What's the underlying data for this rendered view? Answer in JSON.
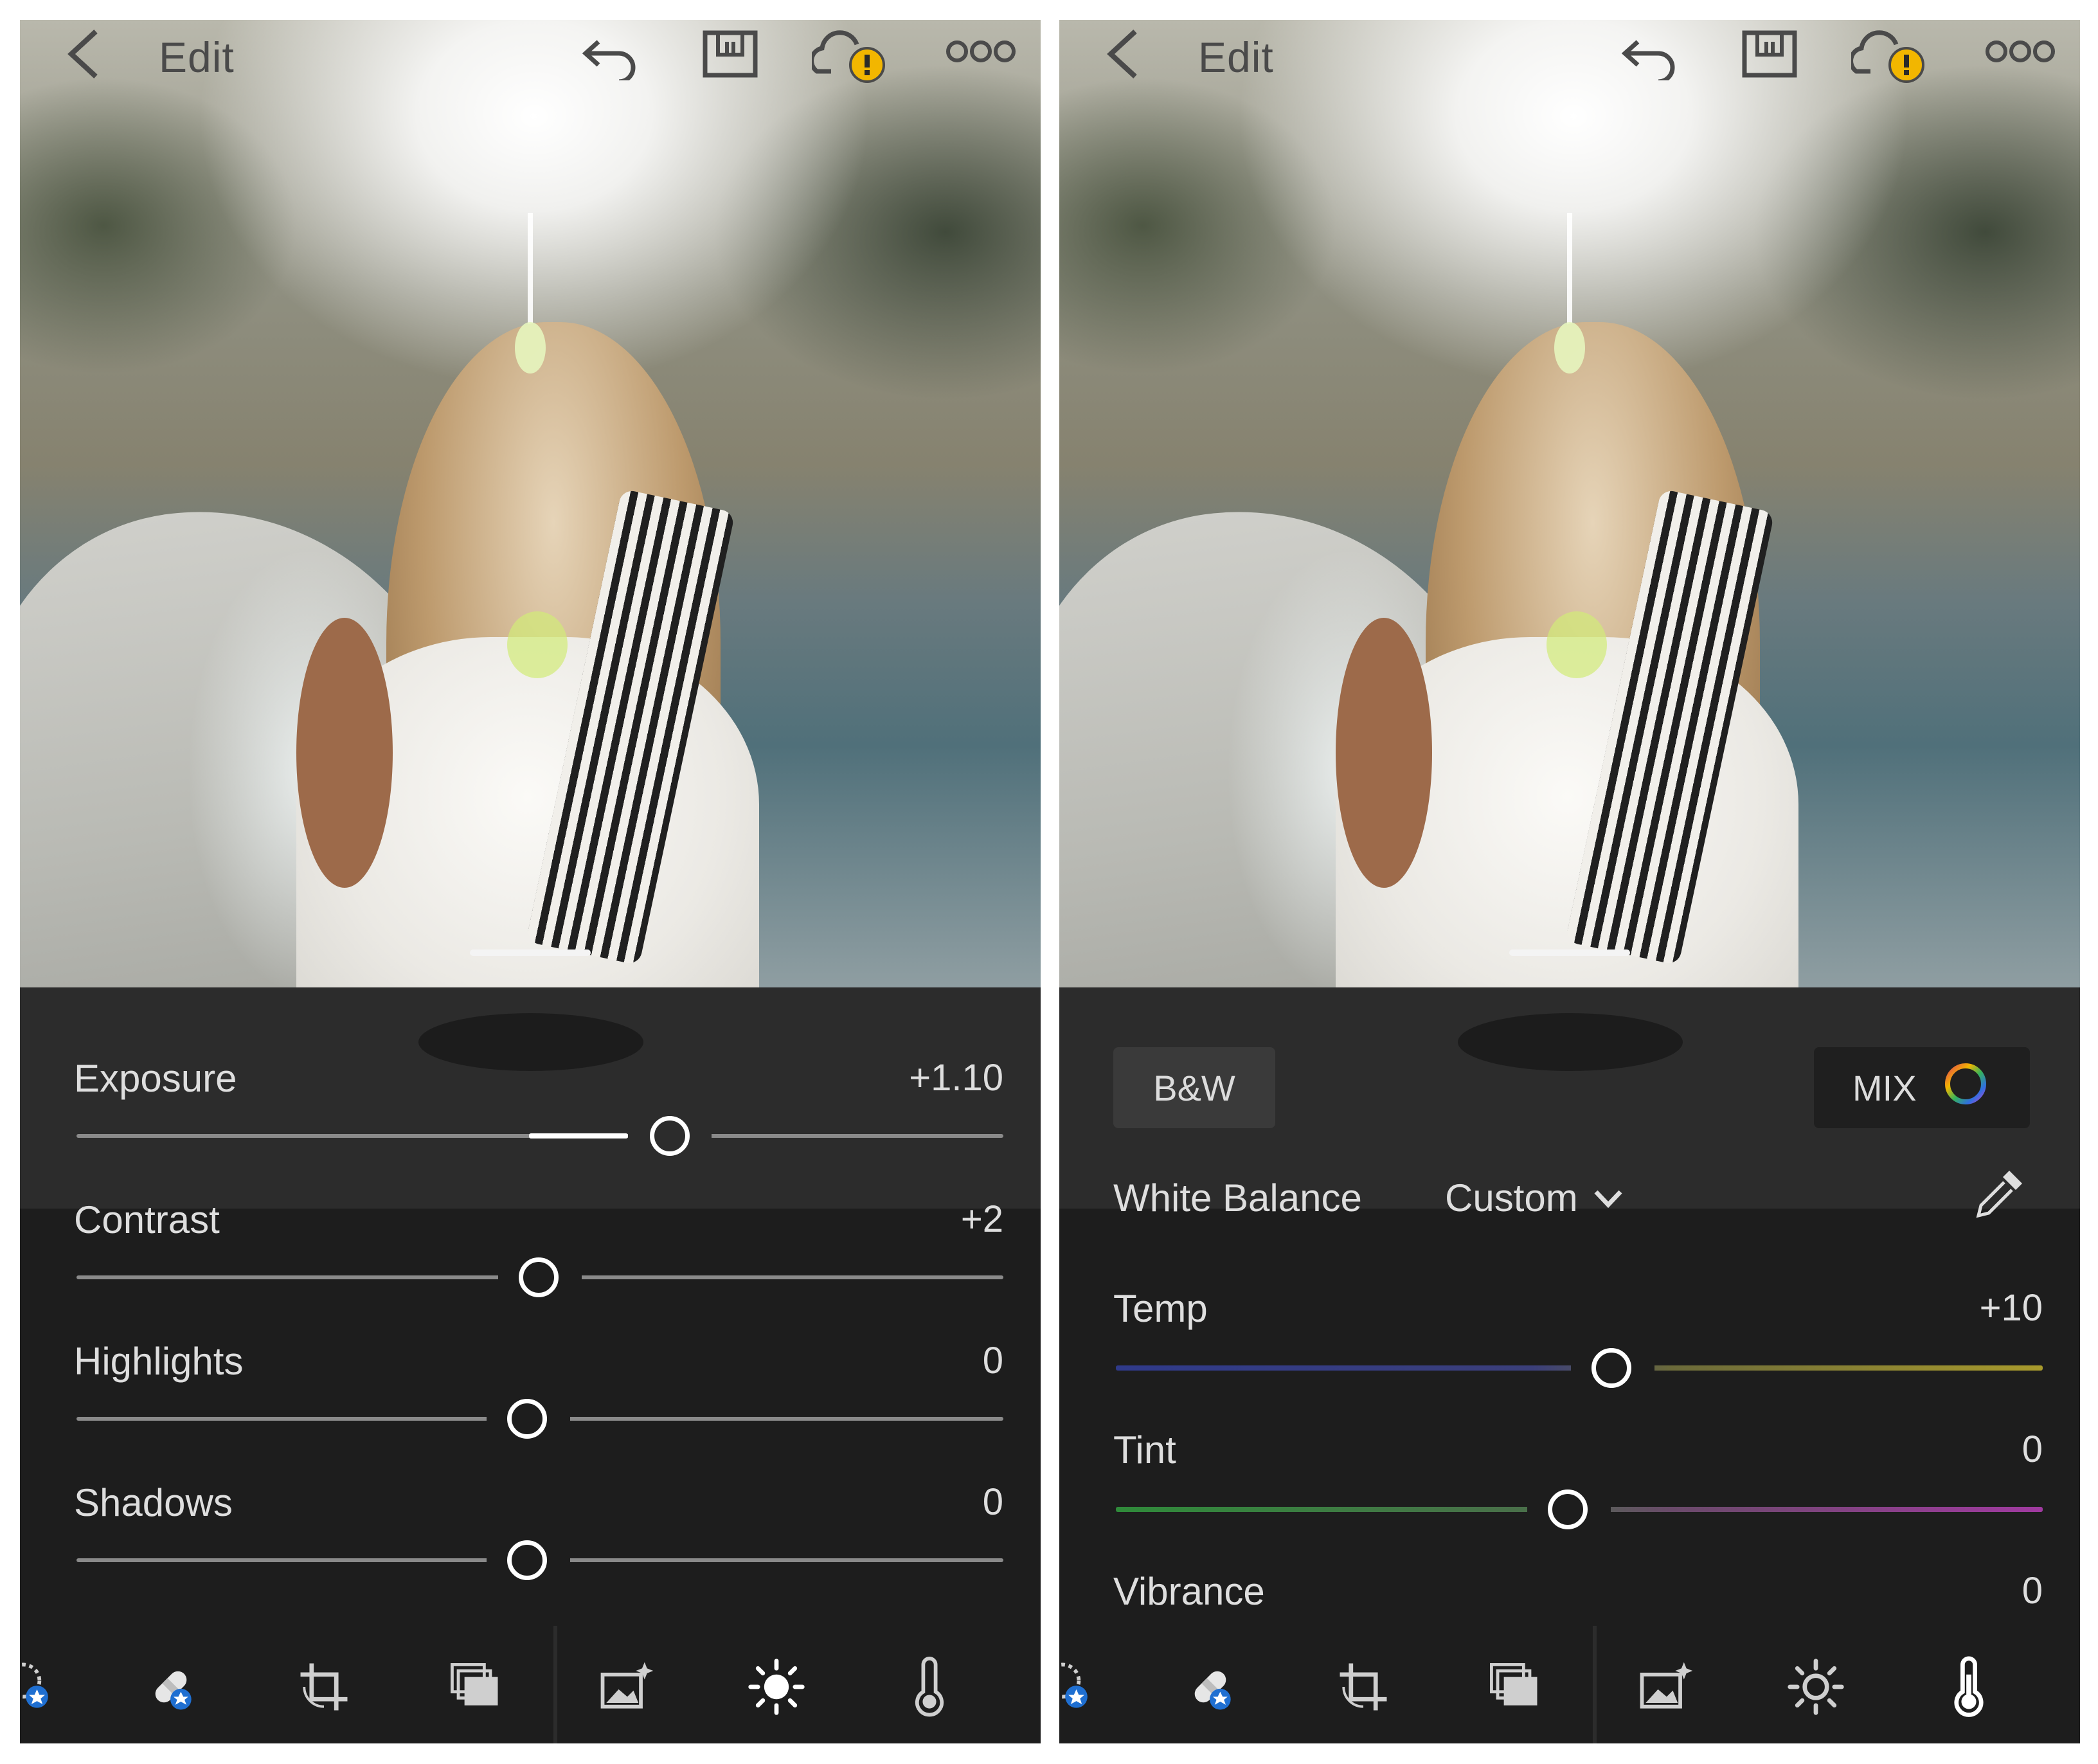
{
  "left_panel": {
    "topbar": {
      "title": "Edit"
    },
    "sliders": [
      {
        "label": "Exposure",
        "value": "+1.10"
      },
      {
        "label": "Contrast",
        "value": "+2"
      },
      {
        "label": "Highlights",
        "value": "0"
      },
      {
        "label": "Shadows",
        "value": "0"
      }
    ],
    "toolbar": {
      "icons": [
        "selective-icon",
        "healing-icon",
        "crop-icon",
        "profile-icon",
        "auto-icon",
        "light-icon",
        "color-icon"
      ],
      "active": "light-icon"
    }
  },
  "right_panel": {
    "topbar": {
      "title": "Edit"
    },
    "bw_label": "B&W",
    "mix_label": "MIX",
    "white_balance": {
      "label": "White Balance",
      "value": "Custom"
    },
    "sliders": [
      {
        "label": "Temp",
        "value": "+10"
      },
      {
        "label": "Tint",
        "value": "0"
      },
      {
        "label": "Vibrance",
        "value": "0"
      }
    ],
    "toolbar": {
      "icons": [
        "selective-icon",
        "healing-icon",
        "crop-icon",
        "profile-icon",
        "auto-icon",
        "light-icon",
        "color-icon"
      ],
      "active": "color-icon"
    }
  },
  "colors": {
    "panel_bg": "#1d1d1d",
    "panel_bg_light": "#2c2c2c",
    "text": "#dedede",
    "accent_badge": "#f2b600",
    "badge_blue": "#1f6fd1"
  }
}
